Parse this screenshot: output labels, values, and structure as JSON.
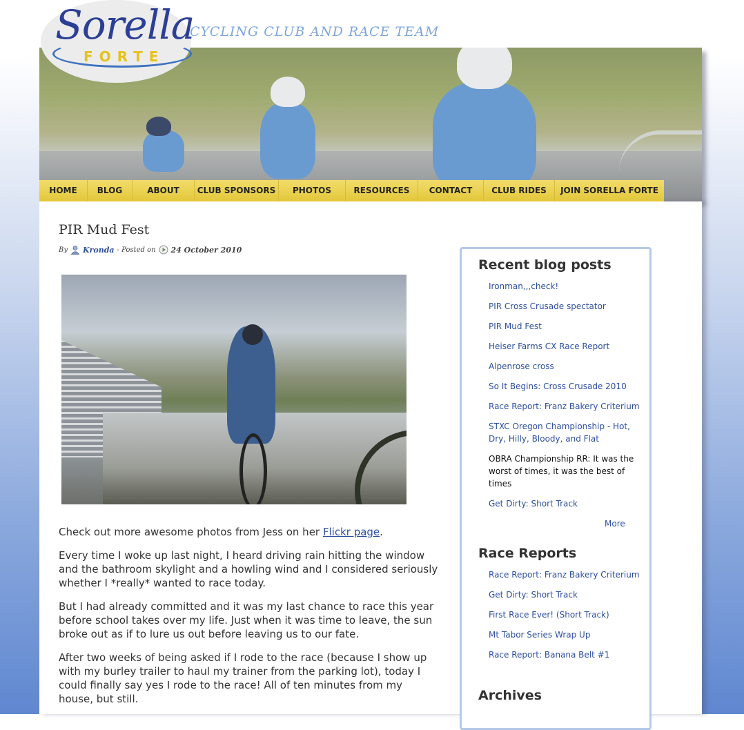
{
  "site": {
    "logo_script": "Sorella",
    "logo_sub": "FORTE",
    "tagline": "CYCLING CLUB AND RACE TEAM"
  },
  "nav": {
    "items": [
      {
        "label": "HOME"
      },
      {
        "label": "BLOG"
      },
      {
        "label": "ABOUT"
      },
      {
        "label": "CLUB SPONSORS"
      },
      {
        "label": "PHOTOS"
      },
      {
        "label": "RESOURCES"
      },
      {
        "label": "CONTACT"
      },
      {
        "label": "CLUB RIDES"
      },
      {
        "label": "JOIN SORELLA FORTE"
      }
    ]
  },
  "post": {
    "title": "PIR Mud Fest",
    "by_label": "By",
    "author": "Kronda",
    "posted_on_label": "- Posted on",
    "date": "24 October 2010",
    "p1_prefix": "Check out more awesome photos from Jess on her ",
    "p1_link": "Flickr page",
    "p1_suffix": ".",
    "p2": "Every time I woke up last night, I heard driving rain hitting the window and the bathroom skylight and a howling wind and I considered seriously whether I *really* wanted to race today.",
    "p3": "But I had already committed and it was my last chance to race this year before school takes over my life. Just when it was time to leave, the sun broke out as if to lure us out before leaving us to our fate.",
    "p4": "After two weeks of being asked if I rode to the race (because I show up with my burley trailer to haul my trainer from the parking lot), today I could finally say yes I rode to the race! All of ten minutes from my house, but still."
  },
  "sidebar": {
    "recent_title": "Recent blog posts",
    "recent_posts": [
      {
        "label": "Ironman,,,check!"
      },
      {
        "label": "PIR Cross Crusade spectator"
      },
      {
        "label": "PIR Mud Fest"
      },
      {
        "label": "Heiser Farms CX Race Report"
      },
      {
        "label": "Alpenrose cross"
      },
      {
        "label": "So It Begins: Cross Crusade 2010"
      },
      {
        "label": "Race Report: Franz Bakery Criterium"
      },
      {
        "label": "STXC Oregon Championship - Hot, Dry, Hilly, Bloody, and Flat"
      },
      {
        "label": "OBRA Championship RR: It was the worst of times, it was the best of times"
      },
      {
        "label": "Get Dirty: Short Track"
      }
    ],
    "more_label": "More",
    "race_title": "Race Reports",
    "race_reports": [
      {
        "label": "Race Report: Franz Bakery Criterium"
      },
      {
        "label": "Get Dirty: Short Track"
      },
      {
        "label": "First Race Ever! (Short Track)"
      },
      {
        "label": "Mt Tabor Series Wrap Up"
      },
      {
        "label": "Race Report: Banana Belt #1"
      }
    ],
    "archives_title": "Archives"
  }
}
